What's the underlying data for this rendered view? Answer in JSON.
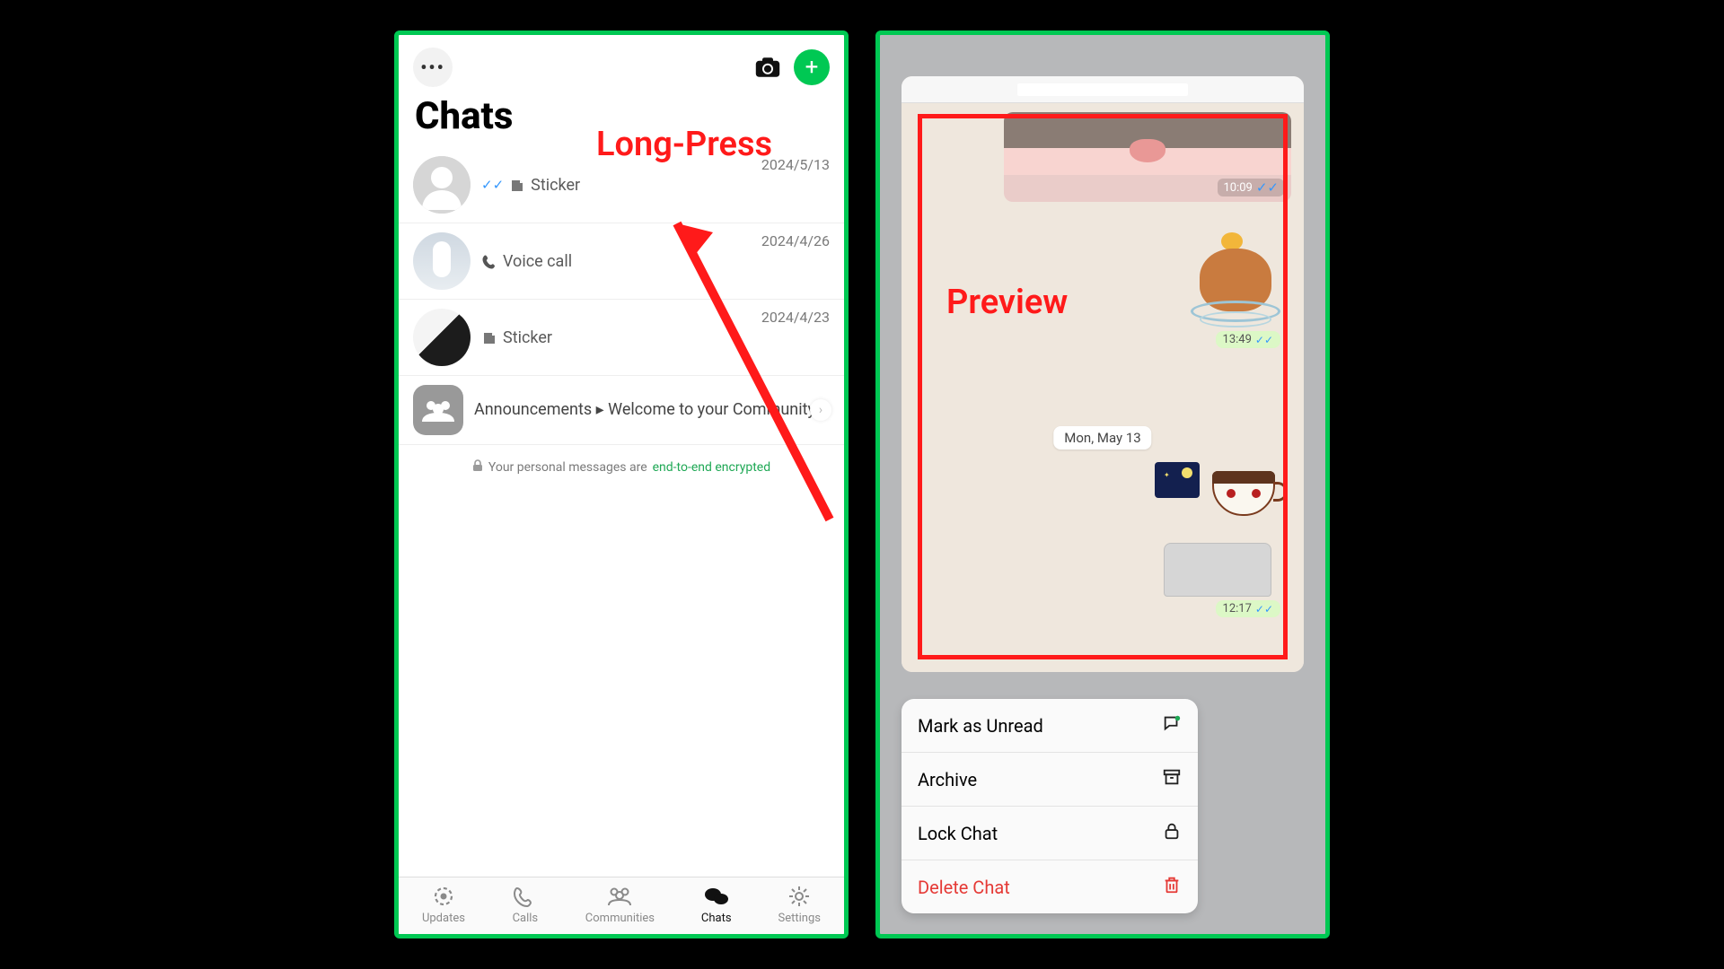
{
  "annotations": {
    "long_press": "Long-Press",
    "preview": "Preview"
  },
  "left": {
    "title": "Chats",
    "chats": [
      {
        "date": "2024/5/13",
        "summary": "Sticker",
        "read_receipt": true
      },
      {
        "date": "2024/4/26",
        "summary": "Voice call"
      },
      {
        "date": "2024/4/23",
        "summary": "Sticker"
      }
    ],
    "community": {
      "title": "Announcements",
      "subtitle": "Welcome to your Community!"
    },
    "encryption_prefix": "Your personal messages are ",
    "encryption_link": "end-to-end encrypted",
    "tabs": [
      {
        "label": "Updates"
      },
      {
        "label": "Calls"
      },
      {
        "label": "Communities"
      },
      {
        "label": "Chats",
        "active": true
      },
      {
        "label": "Settings"
      }
    ]
  },
  "right": {
    "messages": {
      "media_time": "10:09",
      "sticker1_time": "13:49",
      "date_separator": "Mon, May 13",
      "sticker2_time": "12:17"
    },
    "menu": [
      {
        "label": "Mark as Unread",
        "icon": "chat-unread"
      },
      {
        "label": "Archive",
        "icon": "archive"
      },
      {
        "label": "Lock Chat",
        "icon": "lock"
      },
      {
        "label": "Delete Chat",
        "icon": "trash",
        "destructive": true
      }
    ]
  }
}
